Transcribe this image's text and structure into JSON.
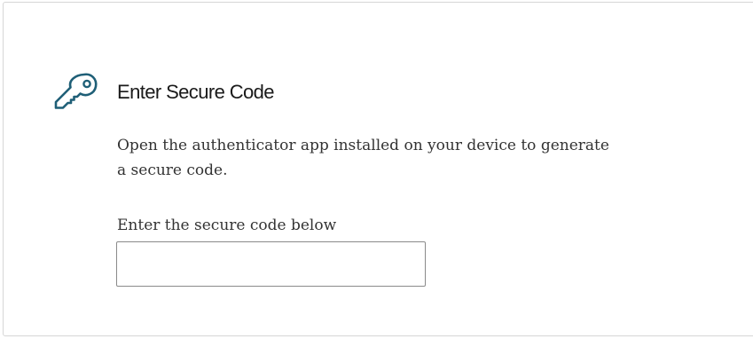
{
  "card": {
    "title": "Enter Secure Code",
    "description": "Open the authenticator app installed on your device to generate a secure code.",
    "icon": "key-icon",
    "accent_color": "#1f5f77"
  },
  "secure_code": {
    "label": "Enter the secure code below",
    "value": "",
    "placeholder": ""
  }
}
